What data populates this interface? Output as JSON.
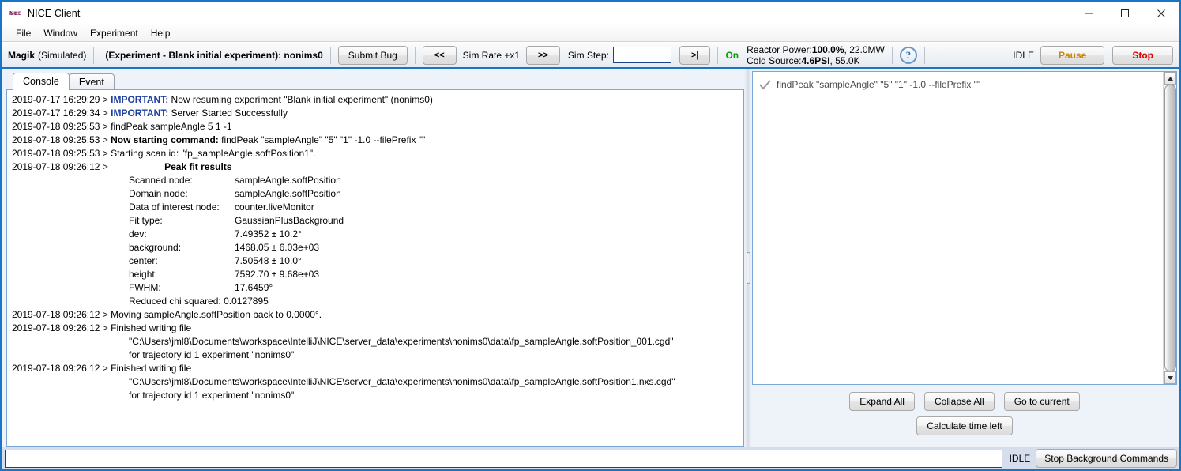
{
  "window": {
    "title": "NICE Client",
    "icon": "nice-logo-icon",
    "minimize_label": "minimize-icon",
    "maximize_label": "maximize-icon",
    "close_label": "close-icon"
  },
  "menubar": {
    "items": [
      {
        "label": "File"
      },
      {
        "label": "Window"
      },
      {
        "label": "Experiment"
      },
      {
        "label": "Help"
      }
    ]
  },
  "toolbar": {
    "instrument_name": "Magik",
    "instrument_mode": "(Simulated)",
    "experiment": "(Experiment - Blank initial experiment): nonims0",
    "submit_bug_label": "Submit Bug",
    "sim_rate_back_label": "<<",
    "sim_rate_label": "Sim Rate +x1",
    "sim_rate_fwd_label": ">>",
    "sim_step_label": "Sim Step:",
    "sim_step_value": "",
    "sim_step_placeholder": "",
    "sim_step_go_label": ">|",
    "on_label": "On",
    "reactor_power_label": "Reactor Power:",
    "reactor_power_value": "100.0%",
    "reactor_power_extra": ", 22.0MW",
    "cold_source_label": "Cold Source:",
    "cold_source_value": "4.6PSI",
    "cold_source_extra": ", 55.0K",
    "help_icon": "?",
    "state_label": "IDLE",
    "pause_label": "Pause",
    "stop_label": "Stop",
    "pause_color": "#c8860a",
    "stop_color": "#e00000",
    "on_color": "#00a000"
  },
  "console": {
    "tabs": [
      {
        "label": "Console",
        "active": true
      },
      {
        "label": "Event",
        "active": false
      }
    ],
    "lines": [
      {
        "kind": "log",
        "ts": "2019-07-17 16:29:29 > ",
        "tag": "IMPORTANT:",
        "text": " Now resuming experiment \"Blank initial experiment\" (nonims0)"
      },
      {
        "kind": "log",
        "ts": "2019-07-17 16:29:34 > ",
        "tag": "IMPORTANT:",
        "text": " Server Started Successfully"
      },
      {
        "kind": "log",
        "ts": "2019-07-18 09:25:53 > ",
        "tag": "",
        "text": "findPeak sampleAngle 5 1 -1"
      },
      {
        "kind": "log",
        "ts": "2019-07-18 09:25:53 > ",
        "tag_bold": "Now starting command:",
        "text": " findPeak \"sampleAngle\" \"5\" \"1\" -1.0 --filePrefix \"\""
      },
      {
        "kind": "log",
        "ts": "2019-07-18 09:25:53 > ",
        "tag": "",
        "text": "Starting scan id: \"fp_sampleAngle.softPosition1\"."
      },
      {
        "kind": "fit-header",
        "ts": "2019-07-18 09:26:12 > ",
        "title": "Peak fit results"
      },
      {
        "kind": "fit",
        "key": "Scanned node:",
        "value": "sampleAngle.softPosition"
      },
      {
        "kind": "fit",
        "key": "Domain node:",
        "value": "sampleAngle.softPosition"
      },
      {
        "kind": "fit",
        "key": "Data of interest node:",
        "value": "counter.liveMonitor"
      },
      {
        "kind": "fit",
        "key": "Fit type:",
        "value": "GaussianPlusBackground"
      },
      {
        "kind": "fit",
        "key": "dev:",
        "value": "7.49352 ± 10.2°"
      },
      {
        "kind": "fit",
        "key": "background:",
        "value": "1468.05 ± 6.03e+03"
      },
      {
        "kind": "fit",
        "key": "center:",
        "value": "7.50548 ± 10.0°"
      },
      {
        "kind": "fit",
        "key": "height:",
        "value": "7592.70 ± 9.68e+03"
      },
      {
        "kind": "fit",
        "key": "FWHM:",
        "value": "17.6459°"
      },
      {
        "kind": "fit-wide",
        "key": "Reduced chi squared:",
        "value": " 0.0127895"
      },
      {
        "kind": "log",
        "ts": "2019-07-18 09:26:12 > ",
        "tag": "",
        "text": "Moving sampleAngle.softPosition back to 0.0000°."
      },
      {
        "kind": "log",
        "ts": "2019-07-18 09:26:12 > ",
        "tag": "",
        "text": "Finished writing file"
      },
      {
        "kind": "cont",
        "text": "\"C:\\Users\\jml8\\Documents\\workspace\\IntelliJ\\NICE\\server_data\\experiments\\nonims0\\data\\fp_sampleAngle.softPosition_001.cgd\""
      },
      {
        "kind": "cont",
        "text": "for trajectory id 1 experiment \"nonims0\""
      },
      {
        "kind": "log",
        "ts": "2019-07-18 09:26:12 > ",
        "tag": "",
        "text": "Finished writing file"
      },
      {
        "kind": "cont",
        "text": "\"C:\\Users\\jml8\\Documents\\workspace\\IntelliJ\\NICE\\server_data\\experiments\\nonims0\\data\\fp_sampleAngle.softPosition1.nxs.cgd\""
      },
      {
        "kind": "cont",
        "text": "for trajectory id 1 experiment \"nonims0\""
      }
    ]
  },
  "command_tree": {
    "rows": [
      {
        "status_icon": "check-icon",
        "label": "findPeak \"sampleAngle\" \"5\" \"1\" -1.0 --filePrefix \"\""
      }
    ],
    "buttons_row1": [
      {
        "label": "Expand All"
      },
      {
        "label": "Collapse All"
      },
      {
        "label": "Go to current"
      }
    ],
    "buttons_row2": [
      {
        "label": "Calculate time left"
      }
    ],
    "scrollbar": {
      "up_arrow": "▲",
      "down_arrow": "▼"
    }
  },
  "bottombar": {
    "command_value": "",
    "command_placeholder": "",
    "state_label": "IDLE",
    "stop_background_label": "Stop Background Commands"
  }
}
